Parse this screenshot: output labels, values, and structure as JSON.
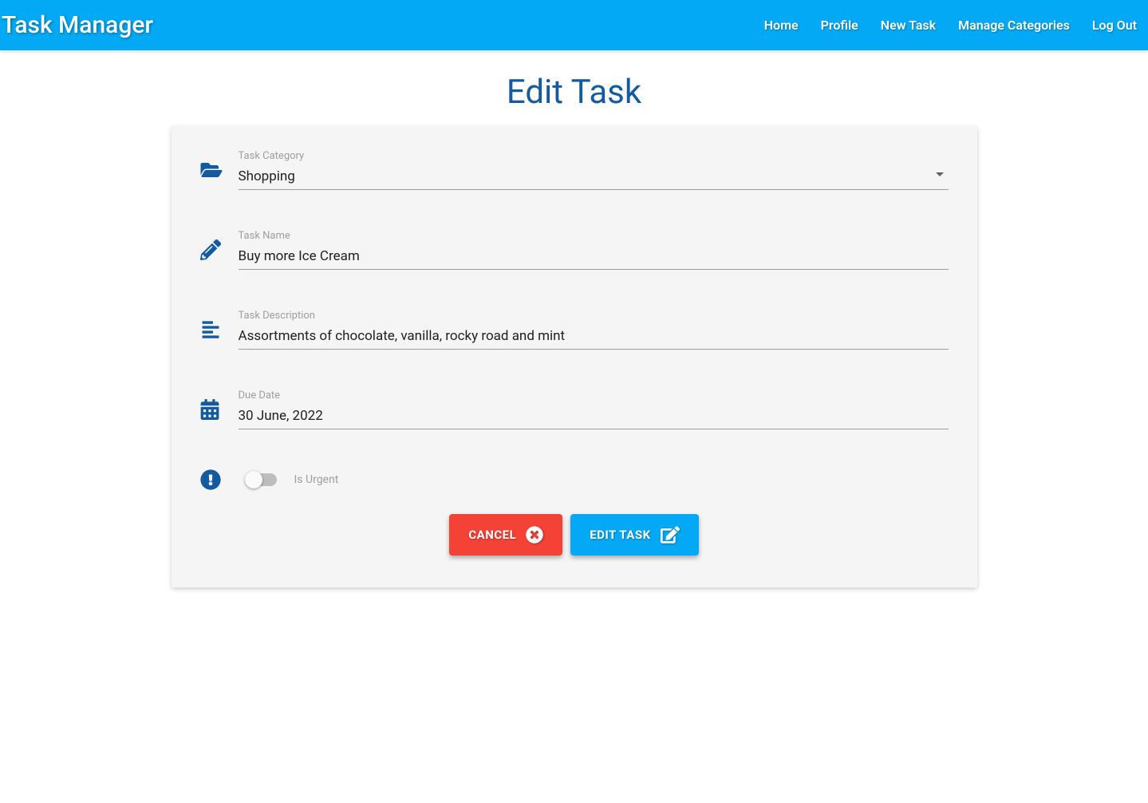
{
  "app": {
    "title": "Task Manager"
  },
  "nav": {
    "home": "Home",
    "profile": "Profile",
    "new_task": "New Task",
    "manage_categories": "Manage Categories",
    "log_out": "Log Out"
  },
  "page": {
    "heading": "Edit Task"
  },
  "form": {
    "category": {
      "label": "Task Category",
      "value": "Shopping"
    },
    "name": {
      "label": "Task Name",
      "value": "Buy more Ice Cream"
    },
    "description": {
      "label": "Task Description",
      "value": "Assortments of chocolate, vanilla, rocky road and mint"
    },
    "due_date": {
      "label": "Due Date",
      "value": "30 June, 2022"
    },
    "urgent": {
      "label": "Is Urgent",
      "value": false
    }
  },
  "buttons": {
    "cancel": "CANCEL",
    "submit": "EDIT TASK"
  }
}
